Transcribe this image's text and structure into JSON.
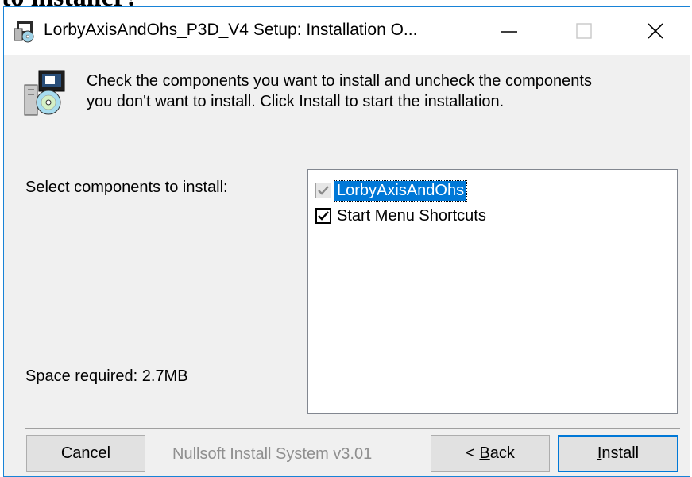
{
  "background_text": "to installer?",
  "window": {
    "title": "LorbyAxisAndOhs_P3D_V4 Setup: Installation O...",
    "minimize_glyph": "—",
    "maximize_glyph": "☐",
    "close_glyph": "✕"
  },
  "header": {
    "line1": "Check the components you want to install and uncheck the components",
    "line2": "you don't want to install. Click Install to start the installation."
  },
  "components": {
    "select_label": "Select components to install:",
    "space_required": "Space required: 2.7MB",
    "items": [
      {
        "label": "LorbyAxisAndOhs",
        "checked": true,
        "disabled": true,
        "selected": true
      },
      {
        "label": "Start Menu Shortcuts",
        "checked": true,
        "disabled": false,
        "selected": false
      }
    ]
  },
  "footer": {
    "cancel_label": "Cancel",
    "branding": "Nullsoft Install System v3.01",
    "back_prefix": "< ",
    "back_mnemonic": "B",
    "back_rest": "ack",
    "install_mnemonic": "I",
    "install_rest": "nstall"
  },
  "colors": {
    "window_border": "#1883d7",
    "selection": "#0078d7",
    "dialog_bg": "#f0f0f0"
  }
}
